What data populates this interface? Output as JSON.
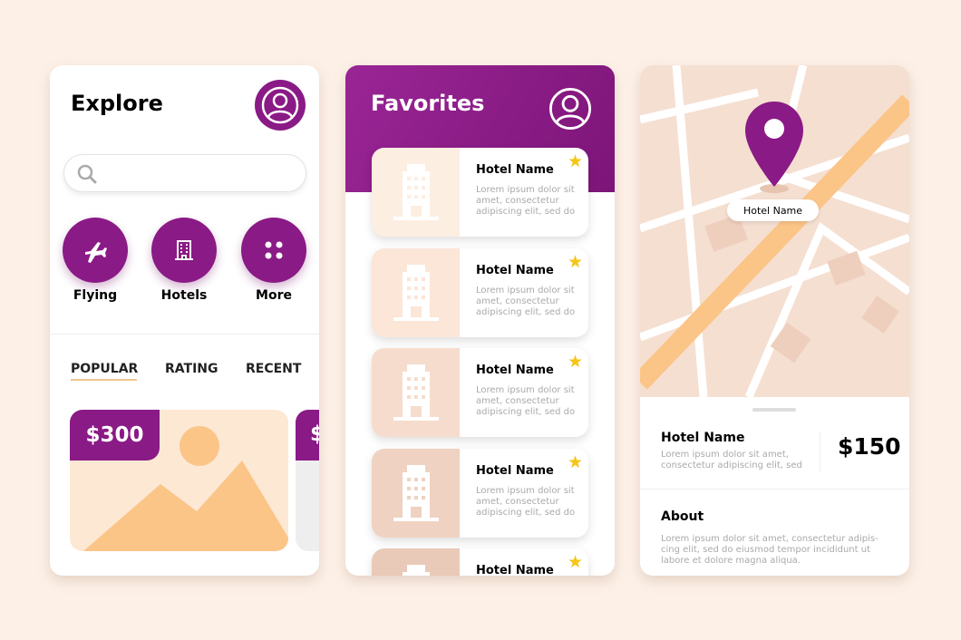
{
  "colors": {
    "accent": "#8a1a85",
    "background": "#fdf1e7",
    "peach": "#fde8d4",
    "road": "#fbc588",
    "star": "#f5c518"
  },
  "explore": {
    "title": "Explore",
    "search": {
      "placeholder": "",
      "value": ""
    },
    "categories": [
      {
        "label": "Flying",
        "icon": "airplane-icon"
      },
      {
        "label": "Hotels",
        "icon": "building-icon"
      },
      {
        "label": "More",
        "icon": "grid-dots-icon"
      }
    ],
    "tabs": [
      {
        "label": "POPULAR",
        "active": true
      },
      {
        "label": "RATING",
        "active": false
      },
      {
        "label": "RECENT",
        "active": false
      }
    ],
    "cards": [
      {
        "price": "$300"
      },
      {
        "price": "$"
      }
    ]
  },
  "favorites": {
    "title": "Favorites",
    "items": [
      {
        "name": "Hotel Name",
        "desc": "Lorem ipsum dolor sit amet, consectetur adipiscing elit, sed do"
      },
      {
        "name": "Hotel Name",
        "desc": "Lorem ipsum dolor sit amet, consectetur adipiscing elit, sed do"
      },
      {
        "name": "Hotel Name",
        "desc": "Lorem ipsum dolor sit amet, consectetur adipiscing elit, sed do"
      },
      {
        "name": "Hotel Name",
        "desc": "Lorem ipsum dolor sit amet, consectetur adipiscing elit, sed do"
      },
      {
        "name": "Hotel Name",
        "desc": ""
      }
    ]
  },
  "detail": {
    "pin_label": "Hotel Name",
    "name": "Hotel Name",
    "desc": "Lorem ipsum dolor sit amet, consectetur adipiscing elit, sed",
    "price": "$150",
    "about_title": "About",
    "about_text": "Lorem ipsum dolor sit amet, consectetur adipis-cing elit, sed do eiusmod tempor incididunt ut labore et dolore magna aliqua."
  }
}
